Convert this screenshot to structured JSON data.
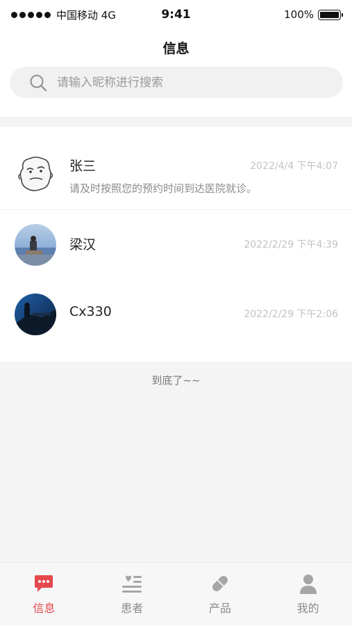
{
  "status_bar": {
    "carrier": "中国移动 4G",
    "time": "9:41",
    "battery": "100%",
    "battery_level": 1.0
  },
  "header": {
    "title": "信息"
  },
  "search": {
    "placeholder": "请输入昵称进行搜索",
    "icon": "search-icon"
  },
  "conversations": [
    {
      "name": "张三",
      "time": "2022/4/4 下午4:07",
      "message": "请及时按照您的预约时间到达医院就诊。",
      "avatar": "cartoon-avatar"
    },
    {
      "name": "梁汉",
      "time": "2022/2/29 下午4:39",
      "message": "",
      "avatar": "photo-avatar-lake"
    },
    {
      "name": "Cx330",
      "time": "2022/2/29 下午2:06",
      "message": "",
      "avatar": "photo-avatar-night"
    }
  ],
  "list_end_text": "到底了~~",
  "tab_bar": {
    "active_color": "#e5484d",
    "inactive_color": "#9a9a9a",
    "tabs": [
      {
        "label": "信息",
        "icon": "message-icon",
        "active": true
      },
      {
        "label": "患者",
        "icon": "patient-list-icon",
        "active": false
      },
      {
        "label": "产品",
        "icon": "pill-icon",
        "active": false
      },
      {
        "label": "我的",
        "icon": "user-icon",
        "active": false
      }
    ]
  }
}
